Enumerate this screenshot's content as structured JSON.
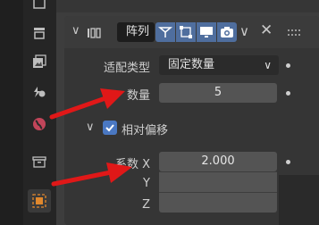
{
  "modifier": {
    "name": "阵列",
    "toggles": [
      "edit-mode-cage-icon",
      "edit-mode-icon",
      "viewport-display-icon",
      "render-icon"
    ]
  },
  "fit_type": {
    "label": "适配类型",
    "value": "固定数量"
  },
  "count": {
    "label": "数量",
    "value": "5"
  },
  "relative_offset": {
    "label": "相对偏移",
    "checked": true
  },
  "factor": {
    "label_x": "系数 X",
    "value_x": "2.000",
    "label_y": "Y",
    "value_y": "",
    "label_z": "Z",
    "value_z": ""
  },
  "colors": {
    "accent": "#4f6e9e",
    "checkbox": "#4a78c2",
    "arrow": "#e01818"
  }
}
